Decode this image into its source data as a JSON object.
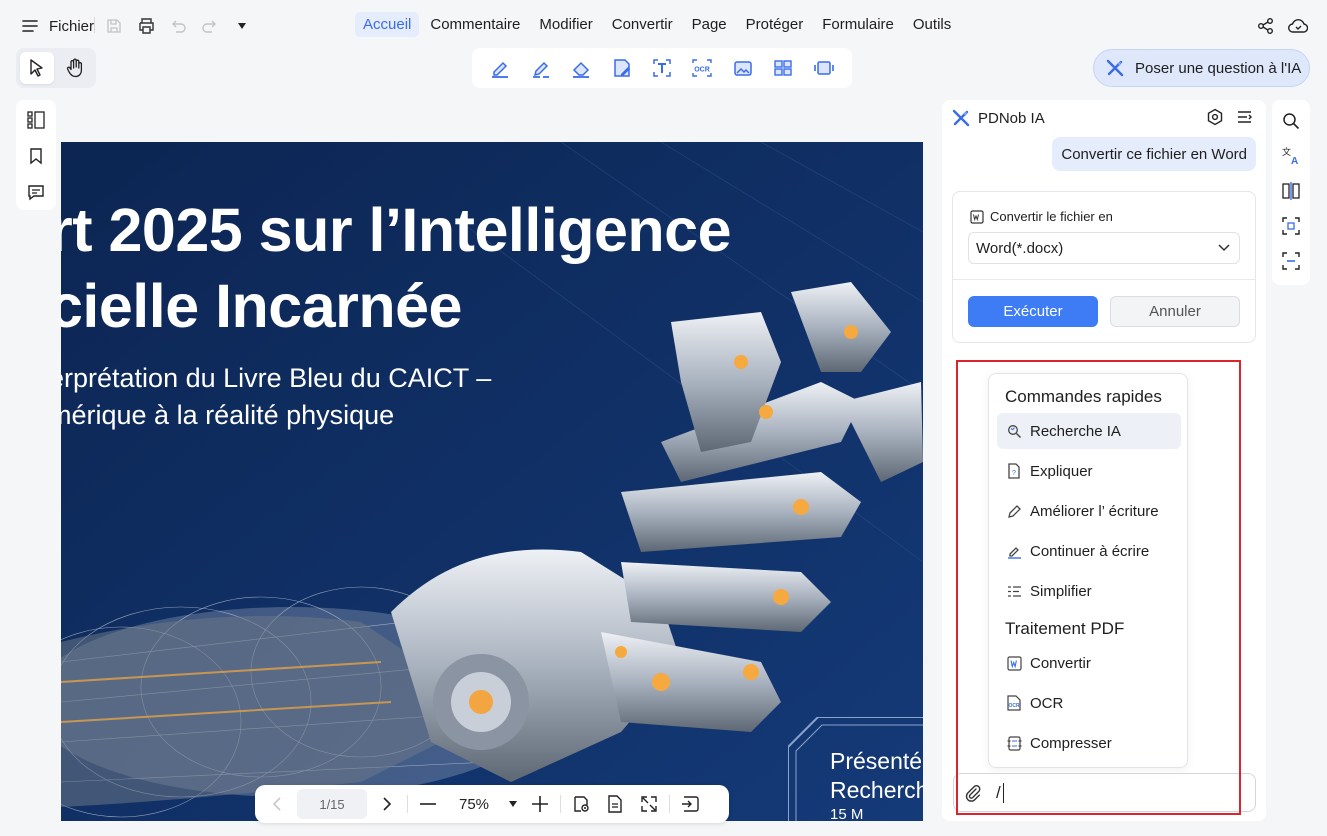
{
  "topbar": {
    "file_label": "Fichier",
    "menu": [
      {
        "label": "Accueil",
        "active": true
      },
      {
        "label": "Commentaire"
      },
      {
        "label": "Modifier"
      },
      {
        "label": "Convertir"
      },
      {
        "label": "Page"
      },
      {
        "label": "Protéger"
      },
      {
        "label": "Formulaire"
      },
      {
        "label": "Outils"
      }
    ],
    "ask_ai_label": "Poser une question à l'IA"
  },
  "ribbon_tools": [
    "highlight-icon",
    "underline-icon",
    "eraser-icon",
    "edit-text-icon",
    "text-recognize-icon",
    "ocr-icon",
    "image-icon",
    "merge-icon",
    "screenshot-icon"
  ],
  "document": {
    "title_line1": "rt 2025 sur l’Intelligence",
    "title_line2": "cielle Incarnée",
    "subtitle_line1": "erprétation du Livre Bleu du CAICT –",
    "subtitle_line2": "mérique à la réalité physique",
    "footer_line1": "Présenté",
    "footer_line2": "Recherch",
    "footer_line3": "15 M"
  },
  "pagebar": {
    "page": "1/15",
    "zoom": "75%"
  },
  "ai_panel": {
    "title": "PDNob IA",
    "user_message": "Convertir ce fichier en Word",
    "convert_label": "Convertir le fichier en",
    "format_value": "Word(*.docx)",
    "run_label": "Exécuter",
    "cancel_label": "Annuler",
    "quick_commands_title": "Commandes rapides",
    "quick_commands": [
      {
        "label": "Recherche IA",
        "icon": "search-ai-icon"
      },
      {
        "label": "Expliquer",
        "icon": "explain-icon"
      },
      {
        "label": "Améliorer l’ écriture",
        "icon": "pen-icon"
      },
      {
        "label": "Continuer à écrire",
        "icon": "continue-write-icon"
      },
      {
        "label": "Simplifier",
        "icon": "simplify-icon"
      }
    ],
    "pdf_processing_title": "Traitement PDF",
    "pdf_commands": [
      {
        "label": "Convertir",
        "icon": "convert-icon"
      },
      {
        "label": "OCR",
        "icon": "ocr-icon"
      },
      {
        "label": "Compresser",
        "icon": "compress-icon"
      }
    ],
    "input_value": "/"
  },
  "colors": {
    "accent": "#3d7cf5",
    "highlight_box": "#d9262c",
    "doc_background": "#0e2a5b"
  }
}
